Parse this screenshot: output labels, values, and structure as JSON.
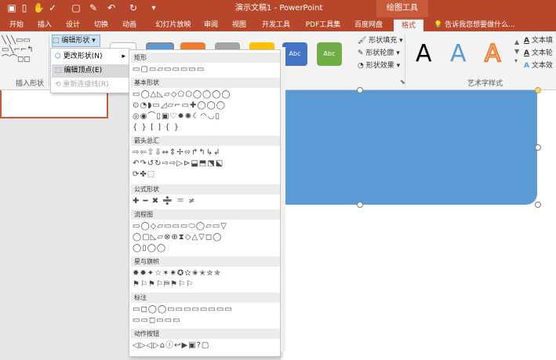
{
  "titlebar": {
    "doc_title": "演示文稿1 - PowerPoint",
    "context_title": "绘图工具",
    "icons": [
      "save-icon",
      "undo-icon",
      "redo-icon",
      "customize-icon"
    ]
  },
  "tabs": [
    "开始",
    "插入",
    "设计",
    "切换",
    "动画",
    "幻灯片放映",
    "审阅",
    "视图",
    "开发工具",
    "PDF工具集",
    "百度网盘",
    "格式"
  ],
  "active_tab": "格式",
  "tell_me": "告诉我您想要做什么...",
  "ribbon": {
    "insert_shapes_label": "插入形状",
    "edit_shape_button": "编辑形状",
    "shape_fill": "形状填充",
    "shape_outline": "形状轮廓",
    "shape_effects": "形状效果",
    "wordart_label": "艺术字样式",
    "text_fill": "文本填",
    "text_outline": "文本轮",
    "text_effects": "文本效",
    "style_sample": "Abc",
    "wordart_letter": "A"
  },
  "edit_menu": {
    "change_shape": "更改形状(N)",
    "edit_points": "编辑顶点(E)",
    "reroute": "重新连接线(R)"
  },
  "gallery": {
    "sections": [
      {
        "title": "矩形",
        "rows": [
          "▭▢▭▱▭▭▭▭▭"
        ]
      },
      {
        "title": "基本形状",
        "rows": [
          "▭◯△◺▱◇⬠⬡◯◯◯◯",
          "⊙◔◗▭◿▱⌐▭✚◯◯◯",
          "◎◉⌒▯▣♡✹✺☾◠◡▯",
          "{ } [ ] { }"
        ]
      },
      {
        "title": "箭头总汇",
        "rows": [
          "⇨⇦⇧⇩⇔⇕✢⬄↱↰↳↲",
          "↶↷↺↻⇨⇨▷⊳⬓⬒⬔⬕",
          "⟳✤⬚"
        ]
      },
      {
        "title": "公式形状",
        "rows": [
          "✚ ━ ✖ ➗ ＝ ≠"
        ]
      },
      {
        "title": "流程图",
        "rows": [
          "▭◯◇▱▭▭▭⬭◯▱▭▽",
          "◯▢◺▱⊗⊕⧗◇△▽◻◯",
          "◯▯◯◯"
        ]
      },
      {
        "title": "星与旗帜",
        "rows": [
          "✸✹✦☆✶✷✪✫✬✭✮✯",
          "⚑⚐⚑⚐⛿⚑⚐⚐"
        ]
      },
      {
        "title": "标注",
        "rows": [
          "▭◻◯◯▭▭▭▭▭▭▭▭",
          "▭▭◻▭▭▭"
        ]
      },
      {
        "title": "动作按钮",
        "rows": [
          "◁▷◁▷⌂ⓘ↩▶▣?▢"
        ]
      }
    ]
  },
  "colors": {
    "accent": "#b7472a",
    "shape_fill": "#5b9bd5",
    "style_blue": "#4472c4",
    "style_orange": "#ed7d31",
    "style_gray": "#a5a5a5",
    "style_yellow": "#ffc000",
    "style_green": "#70ad47"
  }
}
